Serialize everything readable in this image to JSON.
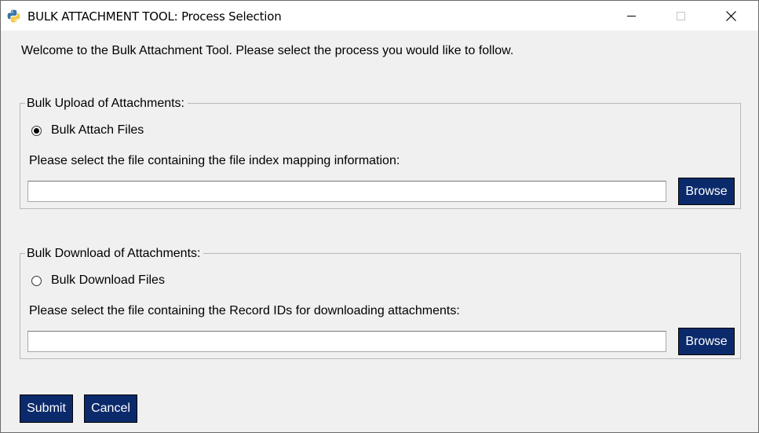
{
  "window": {
    "title": "BULK ATTACHMENT TOOL: Process Selection",
    "app_icon": "python-icon",
    "minimize_icon": "minimize-icon",
    "maximize_icon": "maximize-icon",
    "close_icon": "close-icon",
    "close_glyph": "✕"
  },
  "welcome_text": "Welcome to the Bulk Attachment Tool.  Please select the process you would like to follow.",
  "upload_group": {
    "legend": "Bulk Upload of Attachments:",
    "radio_label": "Bulk Attach Files",
    "radio_selected": true,
    "prompt": "Please select the file containing the file index mapping information:",
    "file_value": "",
    "browse_label": "Browse"
  },
  "download_group": {
    "legend": "Bulk Download of Attachments:",
    "radio_label": "Bulk Download Files",
    "radio_selected": false,
    "prompt": "Please select the file containing the Record IDs for downloading attachments:",
    "file_value": "",
    "browse_label": "Browse"
  },
  "actions": {
    "submit_label": "Submit",
    "cancel_label": "Cancel"
  },
  "colors": {
    "button_bg": "#0b2a6b",
    "button_text": "#ffffff",
    "window_bg": "#f0f0f0"
  }
}
